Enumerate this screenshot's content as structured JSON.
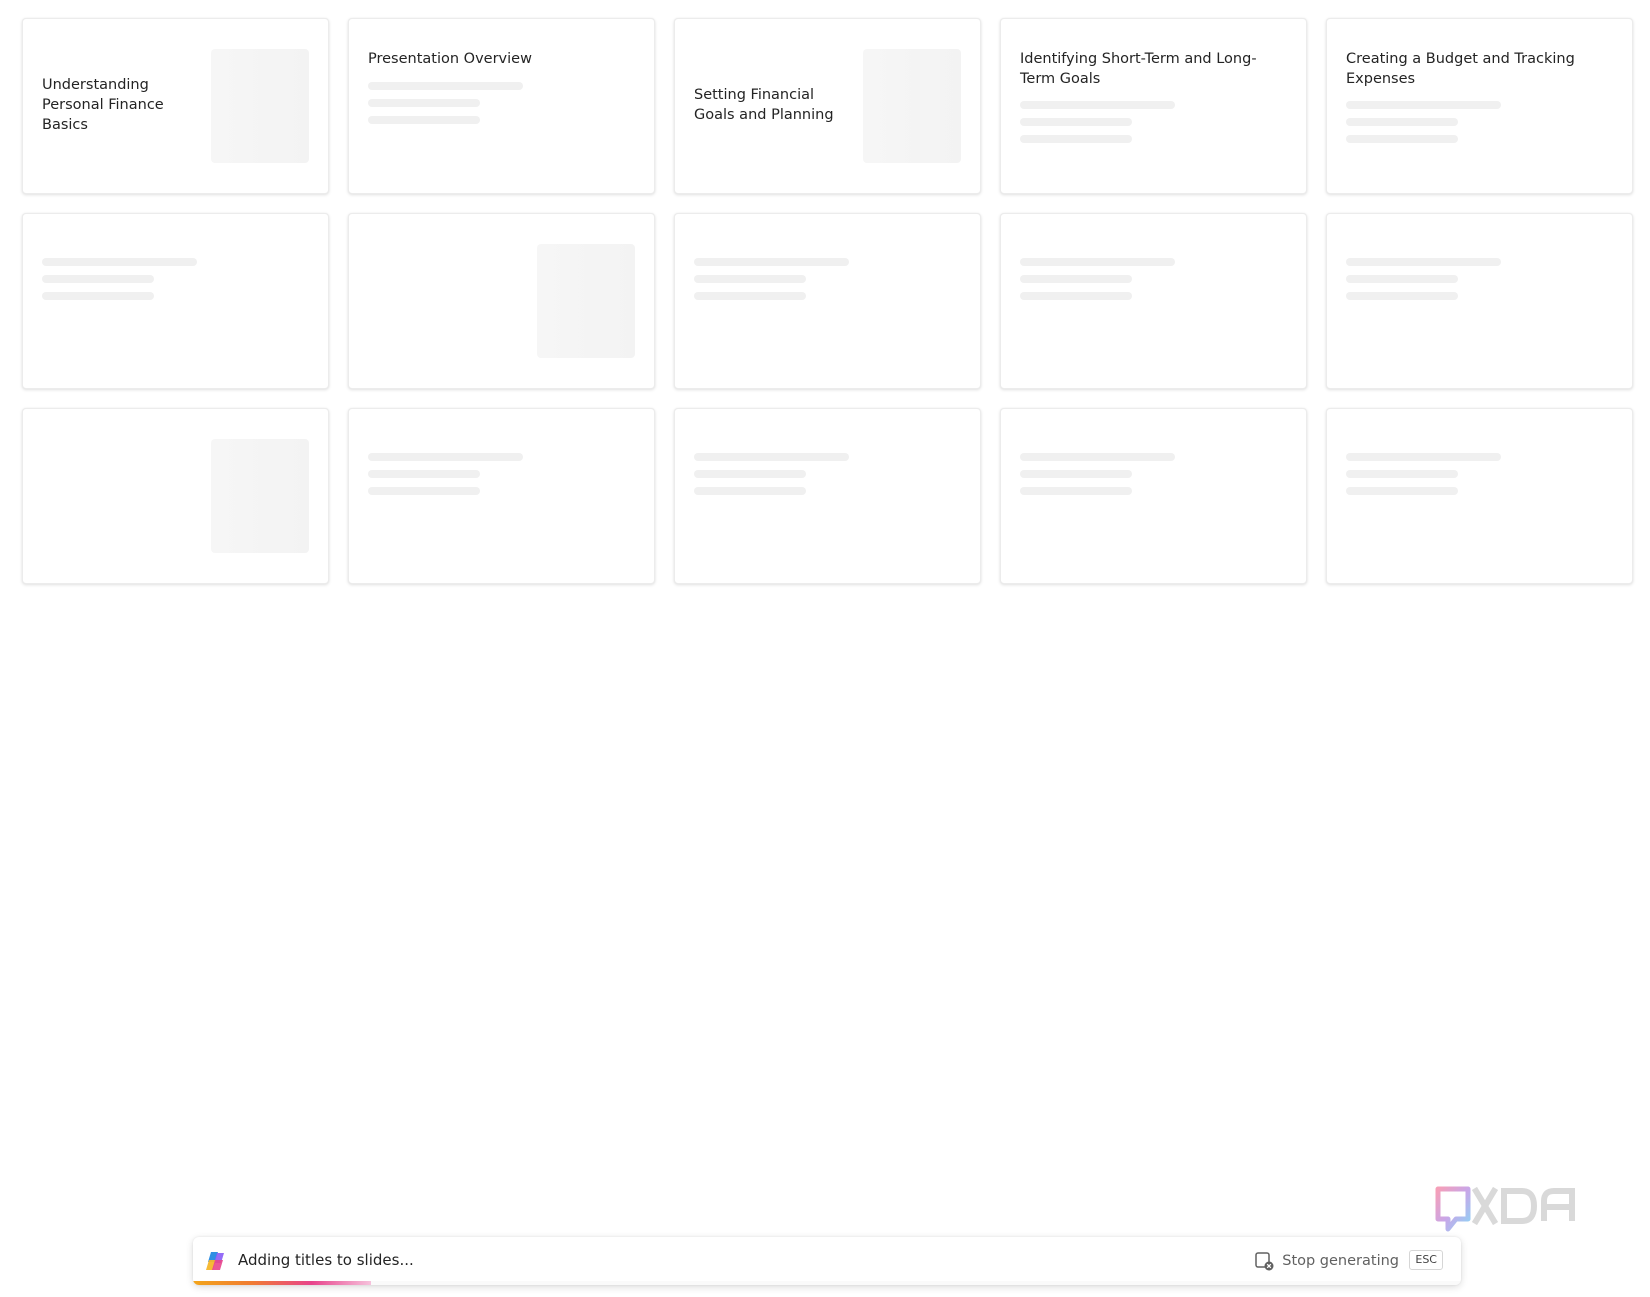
{
  "slides": [
    {
      "title": "Understanding Personal Finance Basics",
      "layout": "title-thumb"
    },
    {
      "title": "Presentation Overview",
      "layout": "title-bars"
    },
    {
      "title": "Setting Financial Goals and Planning",
      "layout": "title-thumb"
    },
    {
      "title": "Identifying Short-Term and Long-Term Goals",
      "layout": "title-bars"
    },
    {
      "title": "Creating a Budget and Tracking Expenses",
      "layout": "title-bars"
    },
    {
      "title": "",
      "layout": "bars"
    },
    {
      "title": "",
      "layout": "thumb"
    },
    {
      "title": "",
      "layout": "bars"
    },
    {
      "title": "",
      "layout": "bars"
    },
    {
      "title": "",
      "layout": "bars"
    },
    {
      "title": "",
      "layout": "thumb"
    },
    {
      "title": "",
      "layout": "bars"
    },
    {
      "title": "",
      "layout": "bars"
    },
    {
      "title": "",
      "layout": "bars"
    },
    {
      "title": "",
      "layout": "bars"
    }
  ],
  "status_bar": {
    "message": "Adding titles to slides...",
    "stop_label": "Stop generating",
    "shortcut": "ESC",
    "progress_fraction": 0.14
  },
  "watermark": {
    "text": "XDA"
  },
  "colors": {
    "text": "#242424",
    "skeleton": "#f0f0f0",
    "progress_start": "#f3a51a",
    "progress_end": "#e8448c"
  },
  "icons": {
    "assistant": "copilot-icon",
    "stop": "stop-generating-icon"
  }
}
